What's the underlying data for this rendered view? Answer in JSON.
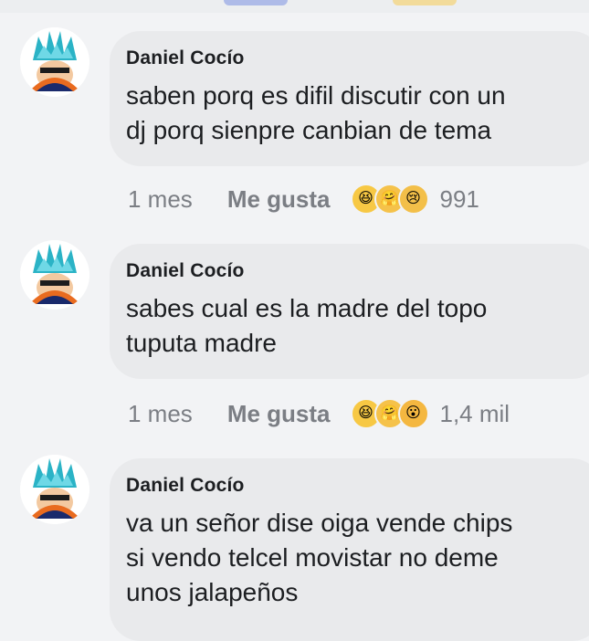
{
  "comments": [
    {
      "author": "Daniel Cocío",
      "lines": [
        "saben porq es difil discutir con un",
        "dj porq sienpre canbian de tema"
      ],
      "time": "1 mes",
      "like_label": "Me gusta",
      "reactions": [
        "haha-reaction-icon",
        "care-reaction-icon",
        "sad-reaction-icon"
      ],
      "reaction_count": "991"
    },
    {
      "author": "Daniel Cocío",
      "lines": [
        "sabes cual es la madre del topo",
        "tuputa madre"
      ],
      "time": "1 mes",
      "like_label": "Me gusta",
      "reactions": [
        "haha-reaction-icon",
        "care-reaction-icon",
        "wow-reaction-icon"
      ],
      "reaction_count": "1,4 mil"
    },
    {
      "author": "Daniel Cocío",
      "lines": [
        "va un señor dise oiga vende chips",
        "si vendo telcel movistar no deme",
        "unos jalapeños"
      ]
    }
  ],
  "colors": {
    "page_bg": "#f2f3f5",
    "bubble_bg": "#e9eaec",
    "text": "#1c1e21",
    "meta_text": "#7b7e84"
  }
}
